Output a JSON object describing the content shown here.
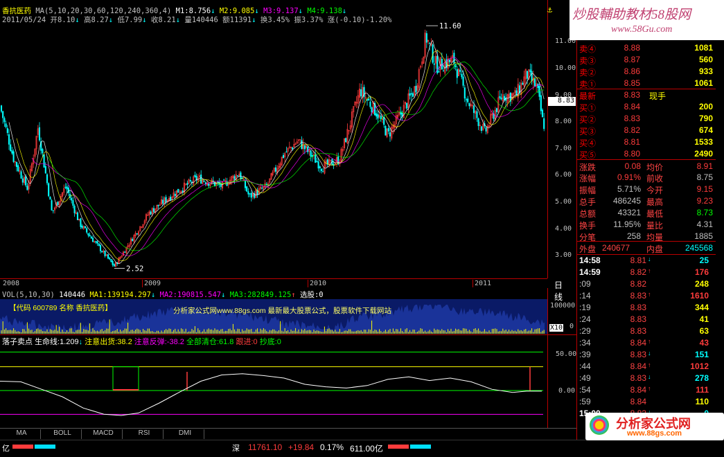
{
  "header": {
    "stock_name": "香抗医药",
    "ma_params": "MA(5,10,20,30,60,120,240,360,4)",
    "m1": "M1:8.756",
    "m2": "M2:9.085",
    "m3": "M3:9.137",
    "m4": "M4:9.138",
    "date": "2011/05/24",
    "open": "开8.10",
    "high": "高8.27",
    "low": "低7.99",
    "close": "收8.21",
    "vol": "量140446",
    "amount": "额11391",
    "turnover": "换3.45%",
    "amplitude": "振3.37%",
    "change": "涨(-0.10)-1.20%"
  },
  "price_axis": [
    "11.00",
    "10.00",
    "9.00",
    "8.00",
    "7.00",
    "6.00",
    "5.00",
    "4.00",
    "3.00"
  ],
  "price_axis_values": [
    11,
    10,
    9,
    8,
    7,
    6,
    5,
    4,
    3
  ],
  "current_price_tag": "8.83",
  "high_marker": "11.60",
  "low_marker": "2.52",
  "year_labels": [
    "2008",
    "2009",
    "2010",
    "2011"
  ],
  "period_label": "日线",
  "volume": {
    "header": "VOL(5,10,30)",
    "vol": "140446",
    "ma1": "MA1:139194.297",
    "ma2": "MA2:190815.547",
    "ma3": "MA3:282849.125",
    "select": "选股:0",
    "axis_top": "100000",
    "axis_zero": "0",
    "axis_unit": "X10",
    "banner_left": "【代码 600789 名称 香抗医药】",
    "banner_mid": "分析家公式网www.88gs.com  最新最大股票公式，股票软件下载网站"
  },
  "indicator": {
    "name": "落子卖点",
    "life": "生命线:1.209",
    "attention": "注意出货:38.2",
    "rebound": "注意反弹:-38.2",
    "clear": "全部清仓:61.8",
    "buy": "跟进:0",
    "bottom": "抄底:0",
    "axis": [
      "50.00",
      "0.00"
    ]
  },
  "tabs": [
    "MA",
    "BOLL",
    "MACD",
    "RSI",
    "DMI"
  ],
  "watermark_top": "炒股輔助教材58股网",
  "watermark_url": "www.58Gu.com",
  "watermark_bottom": "分析家公式网",
  "watermark_bottom_url": "www.88gs.com",
  "order_book": {
    "asks": [
      {
        "label": "卖④",
        "price": "8.88",
        "vol": "1081"
      },
      {
        "label": "卖③",
        "price": "8.87",
        "vol": "560"
      },
      {
        "label": "卖②",
        "price": "8.86",
        "vol": "933"
      },
      {
        "label": "卖①",
        "price": "8.85",
        "vol": "1061"
      }
    ],
    "last": {
      "label": "最新",
      "price": "8.83",
      "extra": "现手"
    },
    "bids": [
      {
        "label": "买①",
        "price": "8.84",
        "vol": "200"
      },
      {
        "label": "买②",
        "price": "8.83",
        "vol": "790"
      },
      {
        "label": "买③",
        "price": "8.82",
        "vol": "674"
      },
      {
        "label": "买④",
        "price": "8.81",
        "vol": "1533"
      },
      {
        "label": "买⑤",
        "price": "8.80",
        "vol": "2490"
      }
    ]
  },
  "stats": [
    {
      "l1": "涨跌",
      "v1": "0.08",
      "l2": "均价",
      "v2": "8.91"
    },
    {
      "l1": "涨幅",
      "v1": "0.91%",
      "l2": "前收",
      "v2": "8.75"
    },
    {
      "l1": "振幅",
      "v1": "5.71%",
      "l2": "今开",
      "v2": "9.15"
    },
    {
      "l1": "总手",
      "v1": "486245",
      "l2": "最高",
      "v2": "9.23"
    },
    {
      "l1": "总额",
      "v1": "43321",
      "l2": "最低",
      "v2": "8.73"
    },
    {
      "l1": "换手",
      "v1": "11.95%",
      "l2": "量比",
      "v2": "4.31"
    },
    {
      "l1": "分笔",
      "v1": "258",
      "l2": "均量",
      "v2": "1885"
    }
  ],
  "outer_inner": {
    "outer_label": "外盘",
    "outer": "240677",
    "inner_label": "内盘",
    "inner": "245568"
  },
  "ticks": [
    {
      "t": "14:58",
      "p": "8.81",
      "a": "↓",
      "v": "25"
    },
    {
      "t": "14:59",
      "p": "8.82",
      "a": "↑",
      "v": "176"
    },
    {
      "t": ":09",
      "p": "8.82",
      "a": "",
      "v": "248"
    },
    {
      "t": ":14",
      "p": "8.83",
      "a": "↑",
      "v": "1610"
    },
    {
      "t": ":19",
      "p": "8.83",
      "a": "",
      "v": "344"
    },
    {
      "t": ":24",
      "p": "8.83",
      "a": "",
      "v": "41"
    },
    {
      "t": ":29",
      "p": "8.83",
      "a": "",
      "v": "63"
    },
    {
      "t": ":34",
      "p": "8.84",
      "a": "↑",
      "v": "43"
    },
    {
      "t": ":39",
      "p": "8.83",
      "a": "↓",
      "v": "151"
    },
    {
      "t": ":44",
      "p": "8.84",
      "a": "↑",
      "v": "1012"
    },
    {
      "t": ":49",
      "p": "8.83",
      "a": "↓",
      "v": "278"
    },
    {
      "t": ":54",
      "p": "8.84",
      "a": "↑",
      "v": "111"
    },
    {
      "t": ":59",
      "p": "8.84",
      "a": "",
      "v": "110"
    },
    {
      "t": "15:00",
      "p": "8.83",
      "a": "↓",
      "v": "0"
    }
  ],
  "status_bar": {
    "left": "亿",
    "index_label": "深",
    "index_value": "11761.10",
    "index_change": "+19.84",
    "index_pct": "0.17%",
    "index_amount": "611.00亿"
  },
  "colors": {
    "up": "#ff3c3c",
    "down": "#00ffff",
    "yellow": "#ffff00",
    "ma1": "#ffffff",
    "ma2": "#ffff00",
    "ma3": "#ff00ff",
    "ma4": "#00ff00"
  }
}
